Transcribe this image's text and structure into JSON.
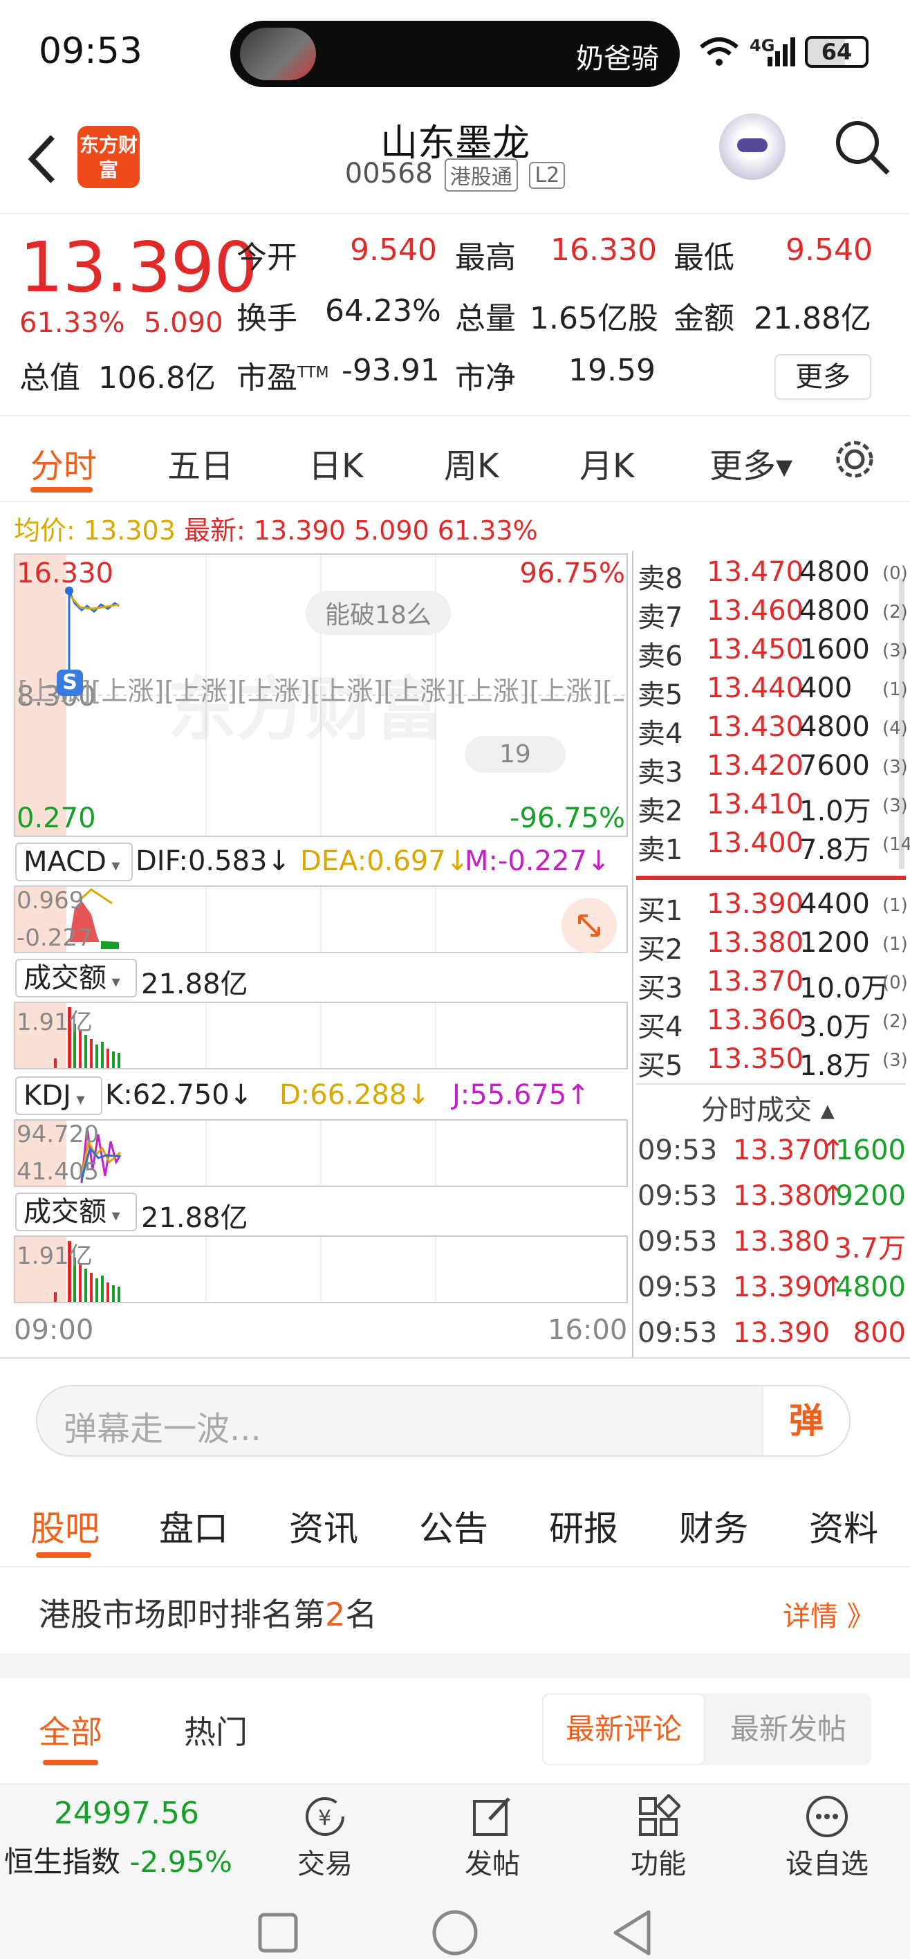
{
  "status_bar": {
    "time": "09:53",
    "island_text": "奶爸骑",
    "battery": "64",
    "network": "4G"
  },
  "header": {
    "back_icon": "chevron-left-icon",
    "logo_text": "东方财富",
    "stock_name": "山东墨龙",
    "code": "00568",
    "tag1": "港股通",
    "tag2": "L2"
  },
  "quote": {
    "price": "13.390",
    "change_pct": "61.33%",
    "change": "5.090",
    "open_label": "今开",
    "open": "9.540",
    "high_label": "最高",
    "high": "16.330",
    "low_label": "最低",
    "low": "9.540",
    "turnover_label": "换手",
    "turnover": "64.23%",
    "volume_label": "总量",
    "volume": "1.65亿股",
    "amount_label": "金额",
    "amount": "21.88亿",
    "mktcap_label": "总值",
    "mktcap": "106.8亿",
    "pe_label": "市盈",
    "pe_sup": "TTM",
    "pe": "-93.91",
    "pb_label": "市净",
    "pb": "19.59",
    "more_label": "更多"
  },
  "tabs": [
    "分时",
    "五日",
    "日K",
    "周K",
    "月K",
    "更多▾"
  ],
  "avg_line": {
    "avg_label": "均价:",
    "avg": "13.303",
    "latest_label": "最新:",
    "latest": "13.390 5.090 61.33%"
  },
  "chart": {
    "top_left": "16.330",
    "top_right": "96.75%",
    "mid_left": "8.300",
    "bottom_left": "0.270",
    "bottom_right": "-96.75%",
    "bubble1": "能破18么",
    "bubble2": "19",
    "limit_marks": "[上涨][上涨][上涨][上涨][上涨][上涨][上涨][上涨][上涨]",
    "watermark": "东方财富",
    "macd": {
      "name": "MACD",
      "dif": "DIF:0.583↓",
      "dea": "DEA:0.697↓",
      "m": "M:-0.227↓",
      "top": "0.969",
      "bottom": "-0.227"
    },
    "vol1": {
      "name": "成交额",
      "value": "21.88亿",
      "top": "1.91亿"
    },
    "kdj": {
      "name": "KDJ",
      "k": "K:62.750↓",
      "d": "D:66.288↓",
      "j": "J:55.675↑",
      "top": "94.720",
      "bottom": "41.405"
    },
    "vol2": {
      "name": "成交额",
      "value": "21.88亿",
      "top": "1.91亿"
    },
    "x_start": "09:00",
    "x_end": "16:00"
  },
  "order_book": {
    "asks": [
      {
        "label": "卖8",
        "price": "13.470",
        "vol": "4800",
        "n": "(0)"
      },
      {
        "label": "卖7",
        "price": "13.460",
        "vol": "4800",
        "n": "(2)"
      },
      {
        "label": "卖6",
        "price": "13.450",
        "vol": "1600",
        "n": "(3)"
      },
      {
        "label": "卖5",
        "price": "13.440",
        "vol": "400",
        "n": "(1)"
      },
      {
        "label": "卖4",
        "price": "13.430",
        "vol": "4800",
        "n": "(4)"
      },
      {
        "label": "卖3",
        "price": "13.420",
        "vol": "7600",
        "n": "(3)"
      },
      {
        "label": "卖2",
        "price": "13.410",
        "vol": "1.0万",
        "n": "(3)"
      },
      {
        "label": "卖1",
        "price": "13.400",
        "vol": "7.8万",
        "n": "(14)"
      }
    ],
    "bids": [
      {
        "label": "买1",
        "price": "13.390",
        "vol": "4400",
        "n": "(1)"
      },
      {
        "label": "买2",
        "price": "13.380",
        "vol": "1200",
        "n": "(1)"
      },
      {
        "label": "买3",
        "price": "13.370",
        "vol": "10.0万",
        "n": "(0)"
      },
      {
        "label": "买4",
        "price": "13.360",
        "vol": "3.0万",
        "n": "(2)"
      },
      {
        "label": "买5",
        "price": "13.350",
        "vol": "1.8万",
        "n": "(3)"
      }
    ],
    "ticks_title": "分时成交 ▴",
    "ticks": [
      {
        "time": "09:53",
        "price": "13.370",
        "arrow": "↑",
        "vol": "1600",
        "dir": "up"
      },
      {
        "time": "09:53",
        "price": "13.380",
        "arrow": "↑",
        "vol": "9200",
        "dir": "up"
      },
      {
        "time": "09:53",
        "price": "13.380",
        "arrow": "",
        "vol": "3.7万",
        "dir": "flat"
      },
      {
        "time": "09:53",
        "price": "13.390",
        "arrow": "↑",
        "vol": "4800",
        "dir": "up"
      },
      {
        "time": "09:53",
        "price": "13.390",
        "arrow": "",
        "vol": "800",
        "dir": "flat"
      }
    ]
  },
  "danmu": {
    "placeholder": "弹幕走一波...",
    "button": "弹"
  },
  "sub_tabs": [
    "股吧",
    "盘口",
    "资讯",
    "公告",
    "研报",
    "财务",
    "资料"
  ],
  "rank": {
    "text_pre": "港股市场即时排名第",
    "rank": "2",
    "text_post": "名",
    "detail": "详情 》"
  },
  "filter": {
    "all": "全部",
    "hot": "热门",
    "latest_comment": "最新评论",
    "latest_post": "最新发帖"
  },
  "bottom_bar": {
    "index_value": "24997.56",
    "index_name": "恒生指数",
    "index_change": "-2.95%",
    "trade": "交易",
    "post": "发帖",
    "func": "功能",
    "watch": "设自选"
  },
  "colors": {
    "up": "#e02a2a",
    "down": "#16a02a",
    "accent": "#f0601a"
  }
}
